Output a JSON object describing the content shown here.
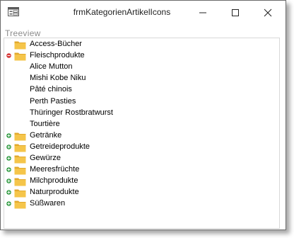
{
  "window": {
    "title": "frmKategorienArtikelIcons"
  },
  "treeview": {
    "label": "Treeview",
    "items": [
      {
        "label": "Access-Bücher",
        "expander": "none"
      },
      {
        "label": "Fleischprodukte",
        "expander": "minus"
      },
      {
        "label": "Alice Mutton",
        "child": true
      },
      {
        "label": "Mishi Kobe Niku",
        "child": true
      },
      {
        "label": "Pâté chinois",
        "child": true
      },
      {
        "label": "Perth Pasties",
        "child": true
      },
      {
        "label": "Thüringer Rostbratwurst",
        "child": true
      },
      {
        "label": "Tourtière",
        "child": true
      },
      {
        "label": "Getränke",
        "expander": "plus"
      },
      {
        "label": "Getreideprodukte",
        "expander": "plus"
      },
      {
        "label": "Gewürze",
        "expander": "plus"
      },
      {
        "label": "Meeresfrüchte",
        "expander": "plus"
      },
      {
        "label": "Milchprodukte",
        "expander": "plus"
      },
      {
        "label": "Naturprodukte",
        "expander": "plus"
      },
      {
        "label": "Süßwaren",
        "expander": "plus"
      }
    ]
  },
  "colors": {
    "folder": "#f5c54a",
    "plus": "#3aa04a",
    "minus": "#d63a3a"
  }
}
